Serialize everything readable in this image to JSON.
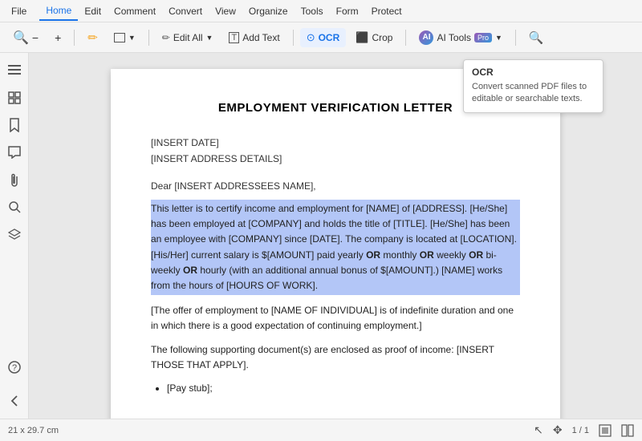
{
  "titlebar": {
    "file_label": "File",
    "controls": [
      "minimize",
      "restore",
      "close"
    ]
  },
  "menu": {
    "items": [
      {
        "label": "Home",
        "active": true
      },
      {
        "label": "Edit"
      },
      {
        "label": "Comment"
      },
      {
        "label": "Convert"
      },
      {
        "label": "View"
      },
      {
        "label": "Organize"
      },
      {
        "label": "Tools"
      },
      {
        "label": "Form"
      },
      {
        "label": "Protect"
      }
    ]
  },
  "toolbar": {
    "zoom_out": "−",
    "zoom_in": "+",
    "highlight": "✏",
    "rect": "▭",
    "edit_all": "Edit All",
    "add_text": "Add Text",
    "ocr": "OCR",
    "crop": "Crop",
    "ai_tools": "AI Tools",
    "search": "🔍"
  },
  "tooltip": {
    "title": "OCR",
    "text": "Convert scanned PDF files to editable or searchable texts."
  },
  "sidebar": {
    "icons": [
      "☰",
      "🔖",
      "💬",
      "📎",
      "🔍",
      "🏷"
    ]
  },
  "document": {
    "title": "EMPLOYMENT VERIFICATION LETTER",
    "insert_date": "[INSERT DATE]",
    "insert_address": "[INSERT ADDRESS DETAILS]",
    "dear": "Dear [INSERT ADDRESSEES NAME],",
    "highlighted_text": "This letter is to certify income and employment for [NAME] of [ADDRESS]. [He/She] has been employed at [COMPANY] and holds the title of [TITLE]. [He/She] has been an employee with [COMPANY] since [DATE]. The company is located at [LOCATION]. [His/Her] current salary is $[AMOUNT] paid yearly OR monthly OR weekly OR bi-weekly OR hourly (with an additional annual bonus of $[AMOUNT].) [NAME] works from the hours of [HOURS OF WORK].",
    "para1": "[The offer of employment to [NAME OF INDIVIDUAL] is of indefinite duration and one in which there is a good expectation of continuing employment.]",
    "para2": "The following supporting document(s) are enclosed as proof of income: [INSERT THOSE THAT APPLY].",
    "list_item1": "[Pay stub];",
    "list_item2": ""
  },
  "statusbar": {
    "dimensions": "21 x 29.7 cm",
    "page_info": "1 / 1",
    "cursor_icon": "↖",
    "move_icon": "✥"
  }
}
